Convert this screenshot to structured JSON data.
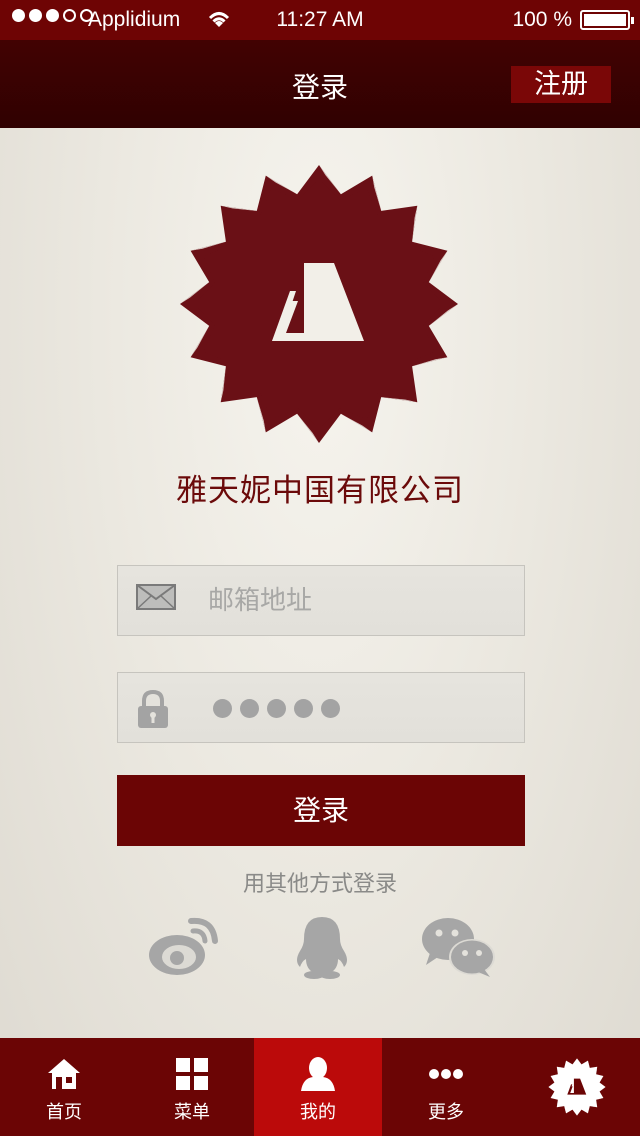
{
  "status_bar": {
    "carrier": "Applidium",
    "time": "11:27 AM",
    "battery": "100 %",
    "signal_icon": "signal-dots-icon",
    "wifi_icon": "wifi-icon",
    "battery_icon": "battery-icon"
  },
  "nav": {
    "title": "登录",
    "register_label": "注册"
  },
  "brand": {
    "company_name": "雅天妮中国有限公司",
    "logo_icon": "brand-badge-icon",
    "color": "#6b0a0a"
  },
  "form": {
    "email_placeholder": "邮箱地址",
    "email_icon": "envelope-icon",
    "password_icon": "lock-icon",
    "password_mask_count": 5,
    "login_label": "登录",
    "other_login_label": "用其他方式登录"
  },
  "social": {
    "icons": [
      "weibo-icon",
      "qq-icon",
      "wechat-icon"
    ]
  },
  "tabs": [
    {
      "label": "首页",
      "icon": "home-icon",
      "active": false
    },
    {
      "label": "菜单",
      "icon": "grid-icon",
      "active": false
    },
    {
      "label": "我的",
      "icon": "user-icon",
      "active": true
    },
    {
      "label": "更多",
      "icon": "more-dots-icon",
      "active": false
    },
    {
      "label": "",
      "icon": "brand-badge-icon",
      "active": false
    }
  ],
  "colors": {
    "accent": "#6b0505",
    "nav_dark": "#360101",
    "tab_active": "#bb0a0a"
  }
}
